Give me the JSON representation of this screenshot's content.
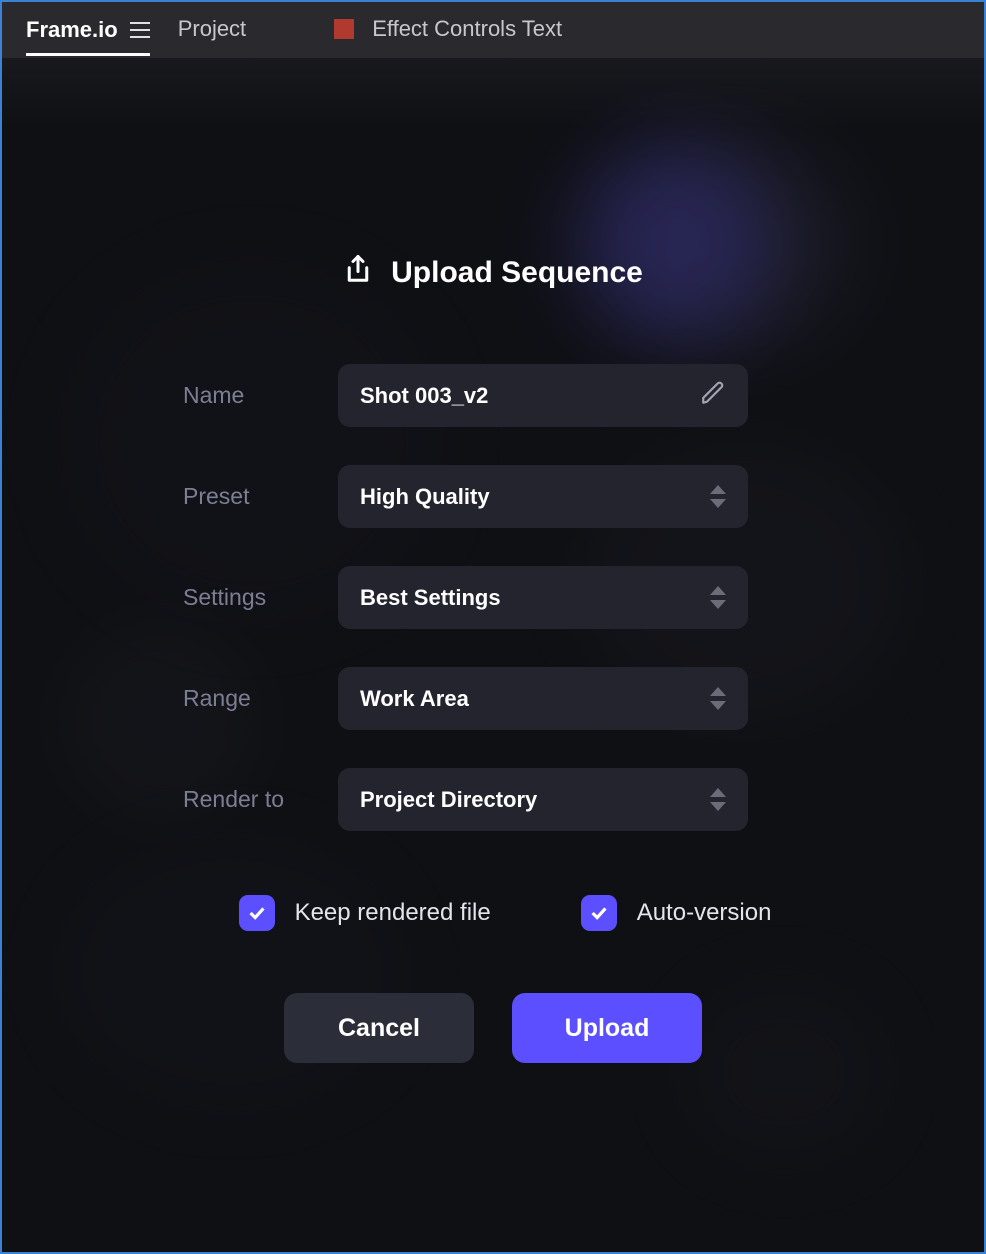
{
  "topbar": {
    "tabs": {
      "frameio": "Frame.io",
      "project": "Project",
      "effect_controls": "Effect Controls Text"
    }
  },
  "dialog": {
    "title": "Upload Sequence",
    "labels": {
      "name": "Name",
      "preset": "Preset",
      "settings": "Settings",
      "range": "Range",
      "render_to": "Render to"
    },
    "values": {
      "name": "Shot 003_v2",
      "preset": "High Quality",
      "settings": "Best Settings",
      "range": "Work Area",
      "render_to": "Project Directory"
    },
    "checkboxes": {
      "keep_rendered_file": {
        "label": "Keep rendered file",
        "checked": true
      },
      "auto_version": {
        "label": "Auto-version",
        "checked": true
      }
    },
    "buttons": {
      "cancel": "Cancel",
      "upload": "Upload"
    }
  },
  "colors": {
    "accent": "#5b4fff",
    "panel": "#23242e",
    "bg": "#0f1014"
  }
}
